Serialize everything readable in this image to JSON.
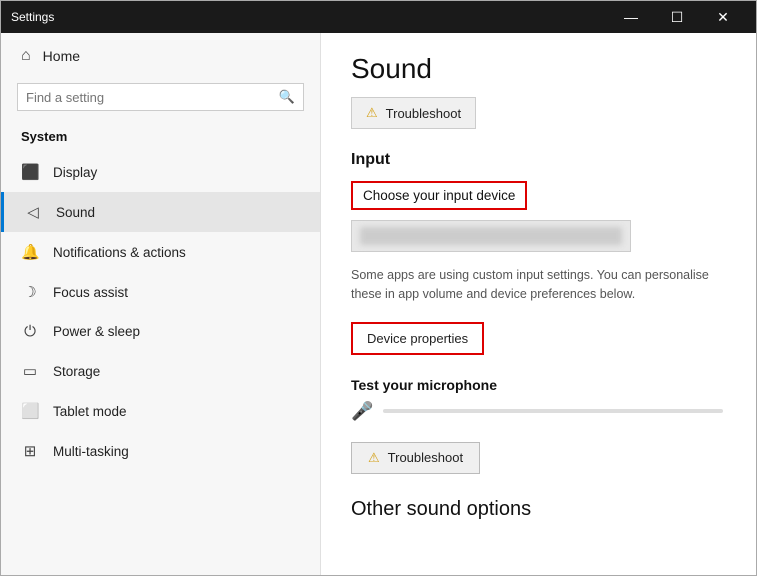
{
  "titleBar": {
    "title": "Settings",
    "minimizeLabel": "—",
    "maximizeLabel": "☐",
    "closeLabel": "✕"
  },
  "sidebar": {
    "homeLabel": "Home",
    "searchPlaceholder": "Find a setting",
    "sectionTitle": "System",
    "items": [
      {
        "id": "display",
        "icon": "🖥",
        "label": "Display"
      },
      {
        "id": "sound",
        "icon": "🔊",
        "label": "Sound"
      },
      {
        "id": "notifications",
        "icon": "🔔",
        "label": "Notifications & actions"
      },
      {
        "id": "focus",
        "icon": "🌙",
        "label": "Focus assist"
      },
      {
        "id": "power",
        "icon": "⏻",
        "label": "Power & sleep"
      },
      {
        "id": "storage",
        "icon": "💾",
        "label": "Storage"
      },
      {
        "id": "tablet",
        "icon": "📱",
        "label": "Tablet mode"
      },
      {
        "id": "multitasking",
        "icon": "⊞",
        "label": "Multi-tasking"
      }
    ]
  },
  "main": {
    "pageTitle": "Sound",
    "troubleshootTopLabel": "Troubleshoot",
    "inputSectionTitle": "Input",
    "chooseDeviceLabel": "Choose your input device",
    "customInputText": "Some apps are using custom input settings. You can personalise these in app volume and device preferences below.",
    "devicePropertiesLabel": "Device properties",
    "testMicTitle": "Test your microphone",
    "troubleshootBottomLabel": "Troubleshoot",
    "otherSoundTitle": "Other sound options",
    "warnIcon": "⚠"
  }
}
